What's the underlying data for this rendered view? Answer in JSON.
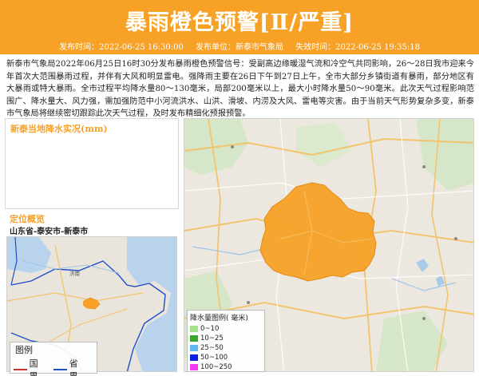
{
  "header": {
    "title": "暴雨橙色预警[Ⅱ/严重]",
    "publish_time": "发布时间：2022-06-25 16:30:00",
    "publish_unit": "发布单位：新泰市气象局",
    "expire_time": "失效时间：2022-06-25 19:35:18"
  },
  "body_text": "新泰市气象局2022年06月25日16时30分发布暴雨橙色预警信号：受副高边缘暖湿气流和冷空气共同影响，26～28日我市迎来今年首次大范围暴雨过程，并伴有大风和明显雷电。强降雨主要在26日下午到27日上午，全市大部分乡镇街道有暴雨，部分地区有大暴雨或特大暴雨。全市过程平均降水量80～130毫米，局部200毫米以上，最大小时降水量50～90毫米。此次天气过程影响范围广、降水量大、风力强，需加强防范中小河流洪水、山洪、滑坡、内涝及大风、雷电等灾害。由于当前天气形势复杂多变，新泰市气象局将继续密切跟踪此次天气过程，及时发布精细化预报预警。",
  "rain_panel": {
    "title": "新泰当地降水实况(mm)"
  },
  "location": {
    "title": "定位概览",
    "path": "山东省-泰安市-新泰市"
  },
  "mini_map": {
    "legend_title": "图例",
    "legend_items": [
      {
        "label": "国界",
        "color": "#d12e2e"
      },
      {
        "label": "省界",
        "color": "#1e4fc8"
      }
    ],
    "labels": [
      "济南"
    ]
  },
  "main_map": {
    "highlight_color": "#f7a126",
    "legend_title": "降水量图例( 毫米)",
    "legend_items": [
      {
        "label": "0~10",
        "color": "#a6e28c"
      },
      {
        "label": "10~25",
        "color": "#3da531"
      },
      {
        "label": "25~50",
        "color": "#63b8f2"
      },
      {
        "label": "50~100",
        "color": "#0a1ee8"
      },
      {
        "label": "100~250",
        "color": "#f23cf2"
      }
    ]
  }
}
